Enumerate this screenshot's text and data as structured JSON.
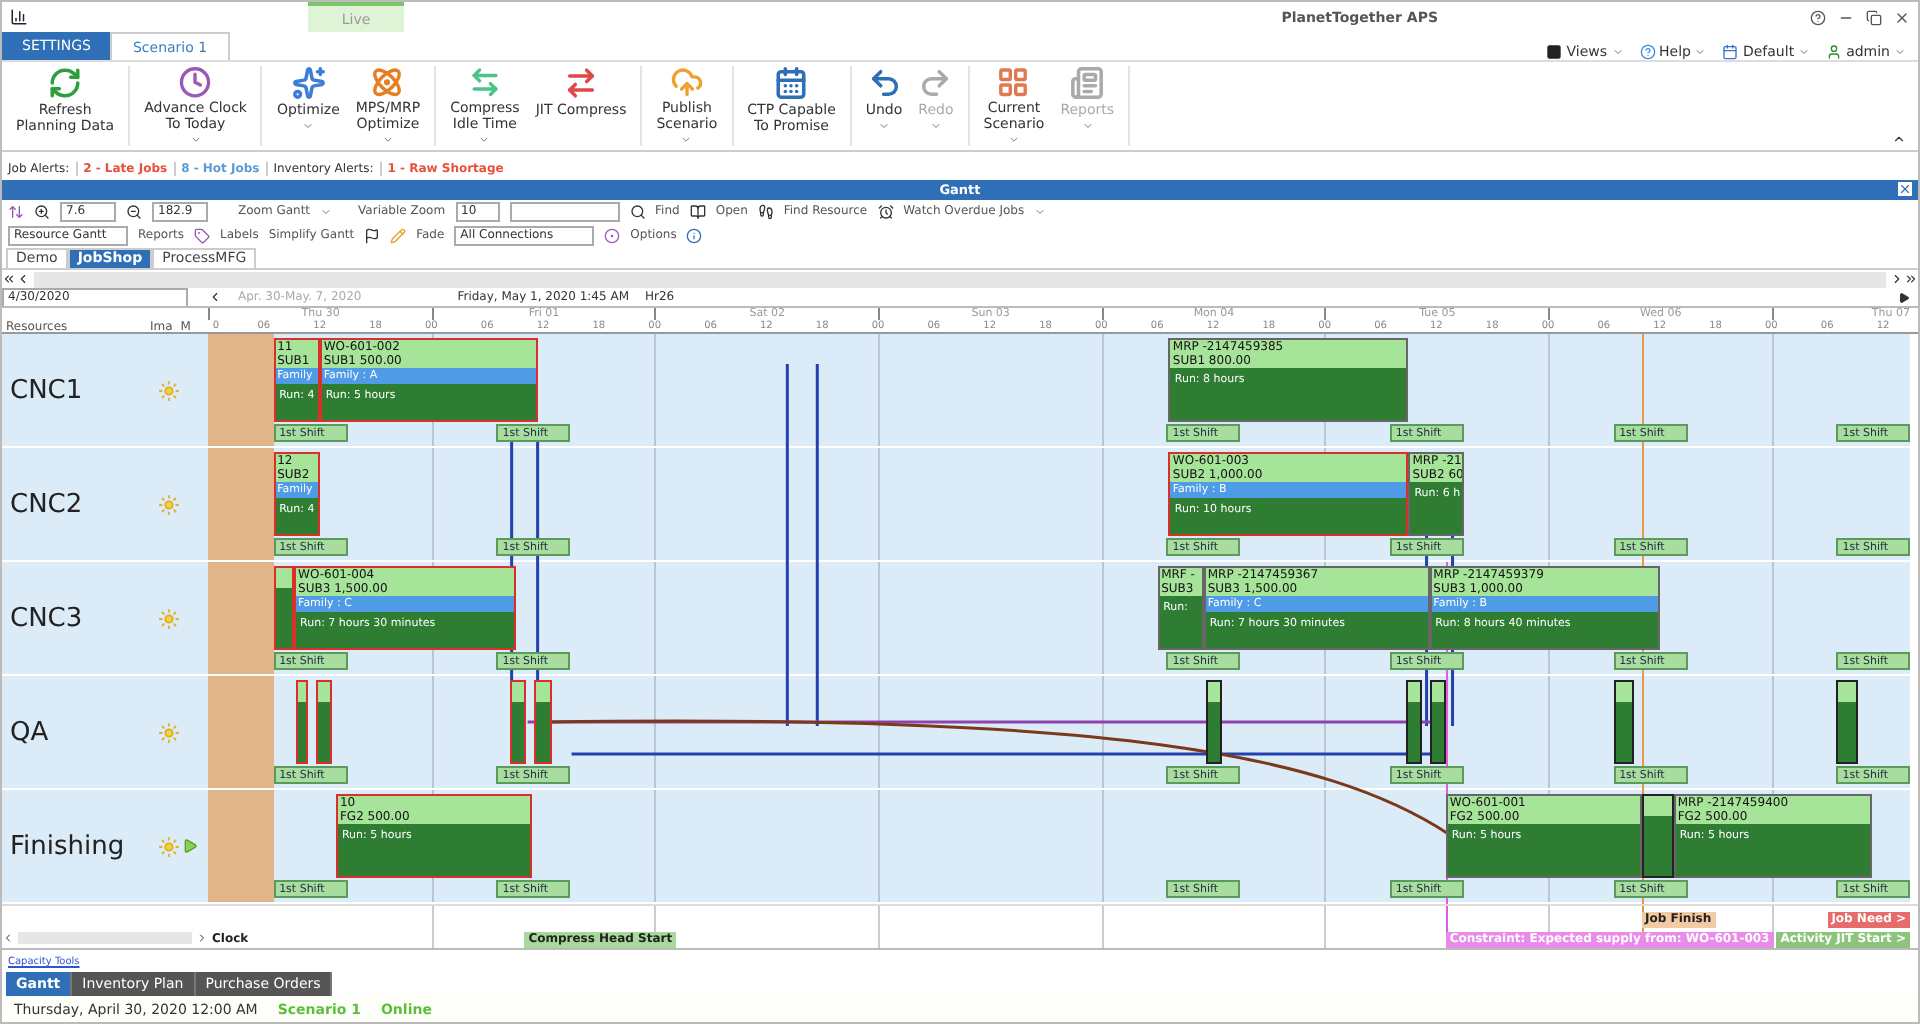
{
  "window": {
    "live_tab": "Live",
    "title": "PlanetTogether APS"
  },
  "tabs": [
    {
      "label": "SETTINGS",
      "kind": "settings",
      "selected": false
    },
    {
      "label": "Scenario 1",
      "kind": "normal",
      "selected": true
    }
  ],
  "user_menu": [
    {
      "label": "Views"
    },
    {
      "label": "Help"
    },
    {
      "label": "Default"
    },
    {
      "label": "admin"
    }
  ],
  "ribbon": {
    "groups": [
      {
        "items": [
          {
            "label": "Refresh\nPlanning Data",
            "dropdown": false,
            "disabled": false
          }
        ]
      },
      {
        "items": [
          {
            "label": "Advance Clock\nTo Today",
            "dropdown": true,
            "disabled": false
          }
        ]
      },
      {
        "items": [
          {
            "label": "Optimize",
            "dropdown": true,
            "disabled": false
          },
          {
            "label": "MPS/MRP\nOptimize",
            "dropdown": true,
            "disabled": false
          }
        ]
      },
      {
        "items": [
          {
            "label": "Compress\nIdle Time",
            "dropdown": true,
            "disabled": false
          },
          {
            "label": "JIT Compress",
            "dropdown": false,
            "disabled": false
          }
        ]
      },
      {
        "items": [
          {
            "label": "Publish\nScenario",
            "dropdown": true,
            "disabled": false
          }
        ]
      },
      {
        "items": [
          {
            "label": "CTP Capable\nTo Promise",
            "dropdown": false,
            "disabled": false
          }
        ]
      },
      {
        "items": [
          {
            "label": "Undo",
            "dropdown": true,
            "disabled": false
          },
          {
            "label": "Redo",
            "dropdown": true,
            "disabled": true
          }
        ]
      },
      {
        "items": [
          {
            "label": "Current\nScenario",
            "dropdown": true,
            "disabled": false
          },
          {
            "label": "Reports",
            "dropdown": true,
            "disabled": true
          }
        ]
      }
    ]
  },
  "alerts": [
    {
      "kind": "heading",
      "label": "Job Alerts:"
    },
    {
      "kind": "alert",
      "label": "2 - Late Jobs",
      "color": "#e8503a"
    },
    {
      "kind": "alert",
      "label": "8 - Hot Jobs",
      "color": "#5b9bd5"
    },
    {
      "kind": "heading",
      "label": "Inventory Alerts:"
    },
    {
      "kind": "alert",
      "label": "1 - Raw Shortage",
      "color": "#e8503a"
    }
  ],
  "gantt": {
    "title": "Gantt",
    "toolbar_1": {
      "zoom_value": "7.6",
      "span_value": "182.9",
      "zoom_gantt": "Zoom Gantt",
      "variable_zoom": "Variable Zoom",
      "variable_value": "10",
      "find": "Find",
      "open": "Open",
      "find_resource": "Find Resource",
      "watch": "Watch Overdue Jobs"
    },
    "toolbar_2": {
      "view": "Resource Gantt",
      "reports": "Reports",
      "labels": "Labels",
      "simplify": "Simplify Gantt",
      "fade": "Fade",
      "connections": "All Connections",
      "options": "Options"
    },
    "view_tabs": [
      {
        "label": "Demo",
        "selected": false
      },
      {
        "label": "JobShop",
        "selected": true
      },
      {
        "label": "ProcessMFG",
        "selected": false
      }
    ],
    "date": "4/30/2020",
    "range": "Apr. 30-May. 7, 2020",
    "cursor_time": "Friday, May 1, 2020 1:45 AM",
    "cursor_hour": "Hr26",
    "columns": [
      "Resources",
      "Ima",
      "M"
    ],
    "days": [
      {
        "label": "Thu 30",
        "hours": [
          "0",
          "06",
          "12",
          "18"
        ]
      },
      {
        "label": "Fri 01",
        "hours": [
          "00",
          "06",
          "12",
          "18"
        ]
      },
      {
        "label": "Sat 02",
        "hours": [
          "00",
          "06",
          "12",
          "18"
        ]
      },
      {
        "label": "Sun 03",
        "hours": [
          "00",
          "06",
          "12",
          "18"
        ]
      },
      {
        "label": "Mon 04",
        "hours": [
          "00",
          "06",
          "12",
          "18"
        ]
      },
      {
        "label": "Tue 05",
        "hours": [
          "00",
          "06",
          "12",
          "18"
        ]
      },
      {
        "label": "Wed 06",
        "hours": [
          "00",
          "06",
          "12",
          "18"
        ]
      },
      {
        "label": "Thu 07",
        "hours": [
          "00",
          "06",
          "12"
        ]
      }
    ],
    "resources": [
      {
        "name": "CNC1",
        "arrow": false,
        "blocks": [
          {
            "kind": "operation",
            "late": true,
            "title": "11",
            "detail": "SUB1",
            "family": "Family",
            "run": "Run: 4"
          },
          {
            "kind": "operation",
            "late": true,
            "title": "WO-601-002",
            "detail": "SUB1 500.00",
            "family": "Family : A",
            "run": "Run: 5 hours"
          },
          {
            "kind": "operation",
            "late": false,
            "title": "MRP -2147459385",
            "detail": "SUB1 800.00",
            "run": "Run: 8 hours"
          }
        ],
        "shifts": [
          "1st Shift",
          "1st Shift",
          "1st Shift",
          "1st Shift",
          "1st Shift",
          "1st Shift"
        ]
      },
      {
        "name": "CNC2",
        "arrow": false,
        "blocks": [
          {
            "kind": "operation",
            "late": true,
            "title": "12",
            "detail": "SUB2",
            "family": "Family",
            "run": "Run: 4"
          },
          {
            "kind": "operation",
            "late": true,
            "title": "WO-601-003",
            "detail": "SUB2 1,000.00",
            "family": "Family : B",
            "run": "Run: 10 hours"
          },
          {
            "kind": "operation",
            "late": false,
            "title": "MRP -21",
            "detail": "SUB2 60",
            "run": "Run: 6 h"
          }
        ],
        "shifts": [
          "1st Shift",
          "1st Shift",
          "1st Shift",
          "1st Shift",
          "1st Shift",
          "1st Shift"
        ]
      },
      {
        "name": "CNC3",
        "arrow": false,
        "blocks": [
          {
            "kind": "mini",
            "late": true
          },
          {
            "kind": "operation",
            "late": true,
            "title": "WO-601-004",
            "detail": "SUB3 1,500.00",
            "family": "Family : C",
            "run": "Run: 7 hours 30 minutes"
          },
          {
            "kind": "operation",
            "late": false,
            "title": "MRF -",
            "detail": "SUB3",
            "run": "Run:"
          },
          {
            "kind": "operation",
            "late": false,
            "title": "MRP -2147459367",
            "detail": "SUB3 1,500.00",
            "family": "Family : C",
            "run": "Run: 7 hours 30 minutes"
          },
          {
            "kind": "operation",
            "late": false,
            "title": "MRP -2147459379",
            "detail": "SUB3 1,000.00",
            "family": "Family : B",
            "run": "Run: 8 hours 40 minutes"
          }
        ],
        "shifts": [
          "1st Shift",
          "1st Shift",
          "1st Shift",
          "1st Shift",
          "1st Shift",
          "1st Shift"
        ]
      },
      {
        "name": "QA",
        "arrow": false,
        "blocks": [
          {
            "kind": "mini",
            "late": true
          },
          {
            "kind": "mini",
            "late": true
          },
          {
            "kind": "mini",
            "late": true
          },
          {
            "kind": "mini",
            "late": true
          },
          {
            "kind": "mini",
            "late": false
          },
          {
            "kind": "mini",
            "late": false
          },
          {
            "kind": "mini",
            "late": false
          },
          {
            "kind": "mini",
            "late": false
          },
          {
            "kind": "mini",
            "late": false
          }
        ],
        "shifts": [
          "1st Shift",
          "1st Shift",
          "1st Shift",
          "1st Shift",
          "1st Shift",
          "1st Shift"
        ]
      },
      {
        "name": "Finishing",
        "arrow": true,
        "blocks": [
          {
            "kind": "operation",
            "late": true,
            "title": "10",
            "detail": "FG2 500.00",
            "run": "Run: 5 hours"
          },
          {
            "kind": "operation",
            "late": false,
            "title": "WO-601-001",
            "detail": "FG2 500.00",
            "run": "Run: 5 hours"
          },
          {
            "kind": "mini",
            "late": false
          },
          {
            "kind": "operation",
            "late": false,
            "title": "MRP -2147459400",
            "detail": "FG2 500.00",
            "run": "Run: 5 hours"
          }
        ],
        "shifts": [
          "1st Shift",
          "1st Shift",
          "1st Shift",
          "1st Shift",
          "1st Shift",
          "1st Shift"
        ]
      }
    ],
    "markers": [
      {
        "kind": "finish",
        "label": "Job Finish"
      },
      {
        "kind": "need",
        "label": "Job Need >"
      },
      {
        "kind": "clock",
        "label": "Clock"
      },
      {
        "kind": "compress",
        "label": "Compress Head Start"
      },
      {
        "kind": "constraint",
        "label": "Constraint: Expected supply from: WO-601-003"
      },
      {
        "kind": "jit",
        "label": "Activity JIT Start >"
      }
    ]
  },
  "capacity_link": "Capacity Tools",
  "bottom_tabs": [
    {
      "label": "Gantt",
      "selected": true
    },
    {
      "label": "Inventory Plan",
      "selected": false
    },
    {
      "label": "Purchase Orders",
      "selected": false
    }
  ],
  "status_bar": {
    "datetime": "Thursday, April 30, 2020  12:00 AM",
    "scenario": "Scenario 1",
    "connection": "Online"
  }
}
